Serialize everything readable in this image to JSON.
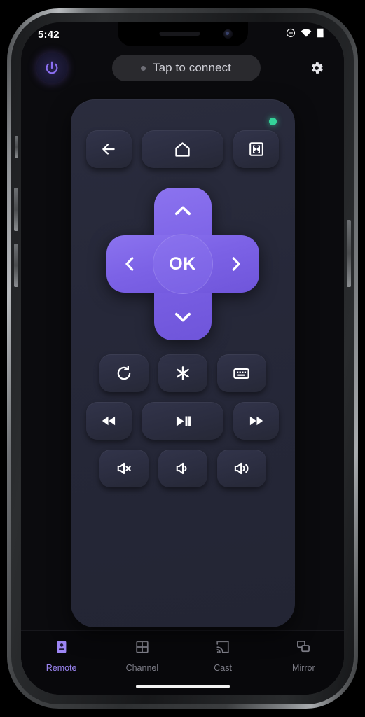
{
  "status_bar": {
    "time": "5:42",
    "icons": [
      "do-not-disturb-icon",
      "wifi-icon",
      "battery-icon"
    ]
  },
  "header": {
    "power_button": "power-icon",
    "connect": {
      "label": "Tap to connect",
      "dot_color": "#6e6e76",
      "connected": false
    },
    "settings_button": "gear-icon"
  },
  "remote": {
    "status_dot_color": "#34d399",
    "accent_color": "#7c62e6",
    "panel_color": "#262839",
    "key_color": "#2e3042",
    "nav_row": [
      {
        "name": "back-button",
        "icon": "arrow-left-icon"
      },
      {
        "name": "home-button",
        "icon": "home-icon"
      },
      {
        "name": "fullscreen-button",
        "icon": "fullscreen-icon"
      }
    ],
    "dpad": {
      "up": "chevron-up-icon",
      "down": "chevron-down-icon",
      "left": "chevron-left-icon",
      "right": "chevron-right-icon",
      "ok_label": "OK"
    },
    "function_row": [
      {
        "name": "replay-button",
        "icon": "replay-icon"
      },
      {
        "name": "options-button",
        "icon": "asterisk-icon"
      },
      {
        "name": "keyboard-button",
        "icon": "keyboard-icon"
      }
    ],
    "playback_row": [
      {
        "name": "rewind-button",
        "icon": "rewind-icon"
      },
      {
        "name": "play-pause-button",
        "icon": "play-pause-icon"
      },
      {
        "name": "fast-forward-button",
        "icon": "fast-forward-icon"
      }
    ],
    "volume_row": [
      {
        "name": "mute-button",
        "icon": "volume-mute-icon"
      },
      {
        "name": "volume-down-button",
        "icon": "volume-down-icon"
      },
      {
        "name": "volume-up-button",
        "icon": "volume-up-icon"
      }
    ]
  },
  "tab_bar": {
    "active_index": 0,
    "active_color": "#9d86f5",
    "inactive_color": "#7c7c86",
    "tabs": [
      {
        "label": "Remote",
        "icon": "remote-icon"
      },
      {
        "label": "Channel",
        "icon": "grid-icon"
      },
      {
        "label": "Cast",
        "icon": "cast-icon"
      },
      {
        "label": "Mirror",
        "icon": "mirror-icon"
      }
    ]
  }
}
